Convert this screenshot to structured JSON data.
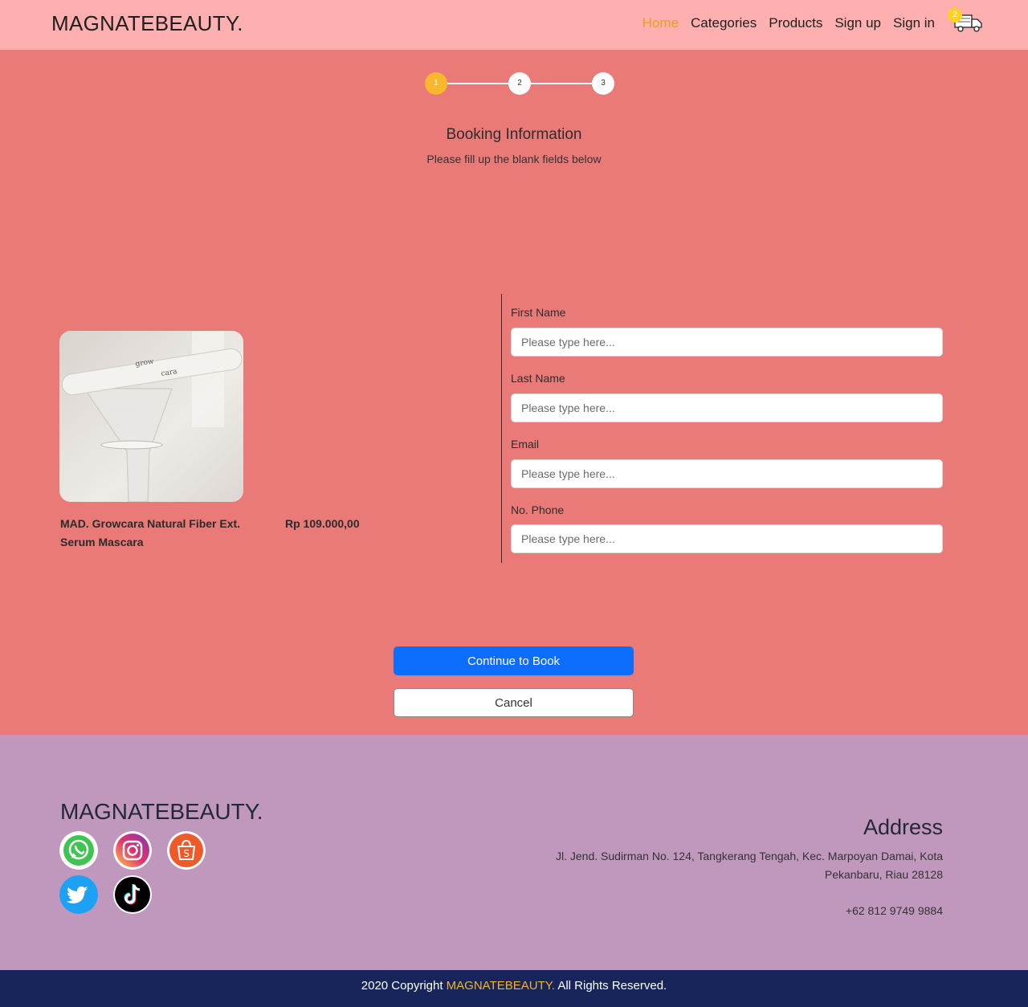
{
  "header": {
    "logo": "MAGNATEBEAUTY.",
    "nav": [
      "Home",
      "Categories",
      "Products",
      "Sign up",
      "Sign in"
    ],
    "cart_count": "2",
    "cart_icon": "truck-icon"
  },
  "stepper": {
    "steps": [
      "1",
      "2",
      "3"
    ],
    "active_step": 1
  },
  "booking": {
    "title": "Booking Information",
    "subtitle": "Please fill up the blank fields below"
  },
  "product": {
    "name": "MAD. Growcara Natural Fiber Ext. Serum Mascara",
    "price": "Rp 109.000,00",
    "image_text_1": "grow",
    "image_text_2": "cara"
  },
  "form": {
    "first_name_label": "First Name",
    "last_name_label": "Last Name",
    "email_label": "Email",
    "phone_label": "No. Phone",
    "placeholder": "Please type here..."
  },
  "buttons": {
    "continue": "Continue to Book",
    "cancel": "Cancel"
  },
  "footer": {
    "logo": "MAGNATEBEAUTY.",
    "social_icons": [
      "whatsapp-icon",
      "instagram-icon",
      "shopee-icon",
      "twitter-icon",
      "tiktok-icon"
    ],
    "address_title": "Address",
    "address_line_1": "Jl. Jend. Sudirman No. 124, Tangkerang Tengah, Kec. Marpoyan Damai, Kota",
    "address_line_2": "Pekanbaru, Riau 28128",
    "phone": "+62 812 9749 9884",
    "copyright_prefix": "2020 Copyright",
    "copyright_brand": "MAGNATEBEAUTY.",
    "copyright_suffix": "All Rights Reserved."
  },
  "colors": {
    "header_bg": "#feafaf",
    "main_bg": "#e97a77",
    "footer_bg": "#c097bd",
    "bottom_bar_bg": "#17255a",
    "accent": "#e7a021",
    "primary_button": "#0d6efd"
  }
}
